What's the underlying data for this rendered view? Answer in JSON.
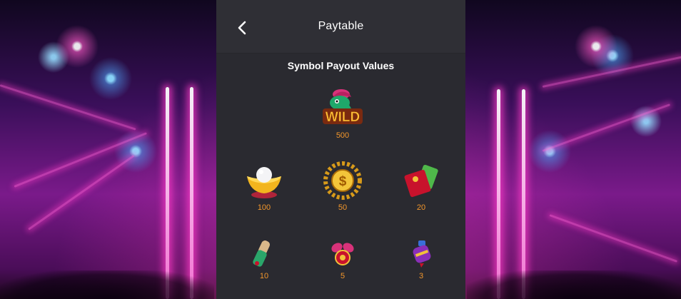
{
  "header": {
    "title": "Paytable",
    "back_icon": "chevron-left-icon"
  },
  "section": {
    "title": "Symbol Payout Values"
  },
  "symbols": [
    {
      "icon": "wild-snake-icon",
      "value": "500"
    },
    {
      "icon": "gold-ingot-pearl-icon",
      "value": "100"
    },
    {
      "icon": "gold-coin-chain-icon",
      "value": "50"
    },
    {
      "icon": "red-envelope-icon",
      "value": "20"
    },
    {
      "icon": "firecracker-icon",
      "value": "10"
    },
    {
      "icon": "knot-charm-icon",
      "value": "5"
    },
    {
      "icon": "lantern-icon",
      "value": "3"
    }
  ],
  "colors": {
    "panel": "#2a2a30",
    "header": "#2f2f35",
    "value": "#f3972b",
    "title": "#ffffff"
  }
}
